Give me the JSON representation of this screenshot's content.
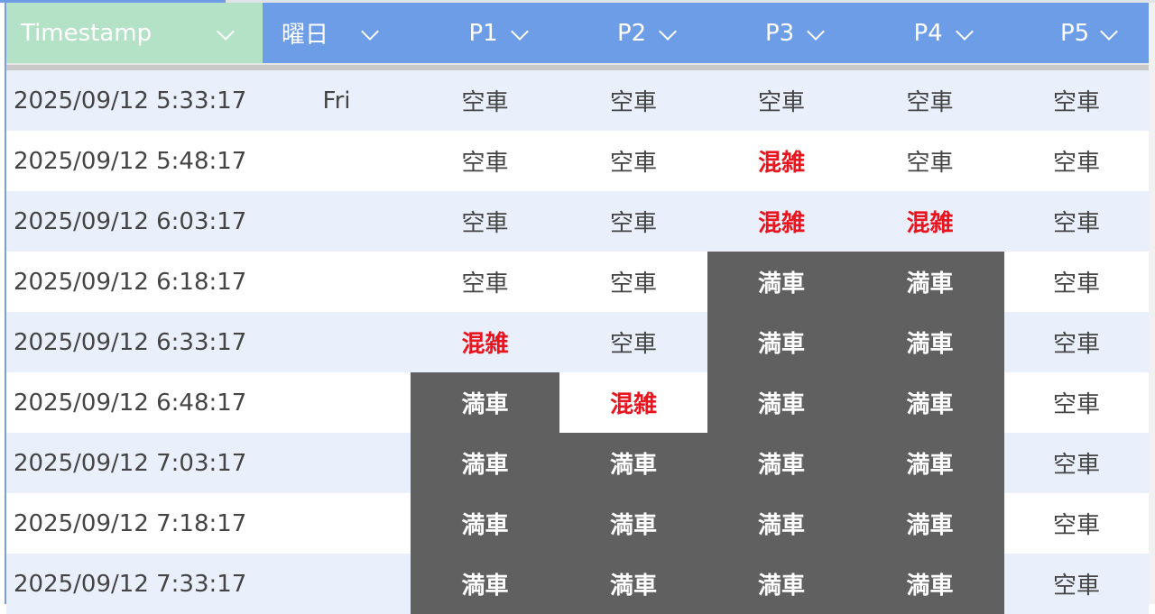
{
  "sheet": {
    "columns": [
      {
        "key": "timestamp",
        "label": "Timestamp"
      },
      {
        "key": "weekday",
        "label": "曜日"
      },
      {
        "key": "p1",
        "label": "P1"
      },
      {
        "key": "p2",
        "label": "P2"
      },
      {
        "key": "p3",
        "label": "P3"
      },
      {
        "key": "p4",
        "label": "P4"
      },
      {
        "key": "p5",
        "label": "P5"
      }
    ],
    "status_colors": {
      "空車": "#444444",
      "混雑": "#e8151f",
      "満車": "#606060"
    },
    "rows": [
      {
        "timestamp": "2025/09/12 5:33:17",
        "weekday": "Fri",
        "p1": "空車",
        "p2": "空車",
        "p3": "空車",
        "p4": "空車",
        "p5": "空車"
      },
      {
        "timestamp": "2025/09/12 5:48:17",
        "weekday": "",
        "p1": "空車",
        "p2": "空車",
        "p3": "混雑",
        "p4": "空車",
        "p5": "空車"
      },
      {
        "timestamp": "2025/09/12 6:03:17",
        "weekday": "",
        "p1": "空車",
        "p2": "空車",
        "p3": "混雑",
        "p4": "混雑",
        "p5": "空車"
      },
      {
        "timestamp": "2025/09/12 6:18:17",
        "weekday": "",
        "p1": "空車",
        "p2": "空車",
        "p3": "満車",
        "p4": "満車",
        "p5": "空車"
      },
      {
        "timestamp": "2025/09/12 6:33:17",
        "weekday": "",
        "p1": "混雑",
        "p2": "空車",
        "p3": "満車",
        "p4": "満車",
        "p5": "空車"
      },
      {
        "timestamp": "2025/09/12 6:48:17",
        "weekday": "",
        "p1": "満車",
        "p2": "混雑",
        "p3": "満車",
        "p4": "満車",
        "p5": "空車"
      },
      {
        "timestamp": "2025/09/12 7:03:17",
        "weekday": "",
        "p1": "満車",
        "p2": "満車",
        "p3": "満車",
        "p4": "満車",
        "p5": "空車"
      },
      {
        "timestamp": "2025/09/12 7:18:17",
        "weekday": "",
        "p1": "満車",
        "p2": "満車",
        "p3": "満車",
        "p4": "満車",
        "p5": "空車"
      },
      {
        "timestamp": "2025/09/12 7:33:17",
        "weekday": "",
        "p1": "満車",
        "p2": "満車",
        "p3": "満車",
        "p4": "満車",
        "p5": "空車"
      }
    ]
  }
}
